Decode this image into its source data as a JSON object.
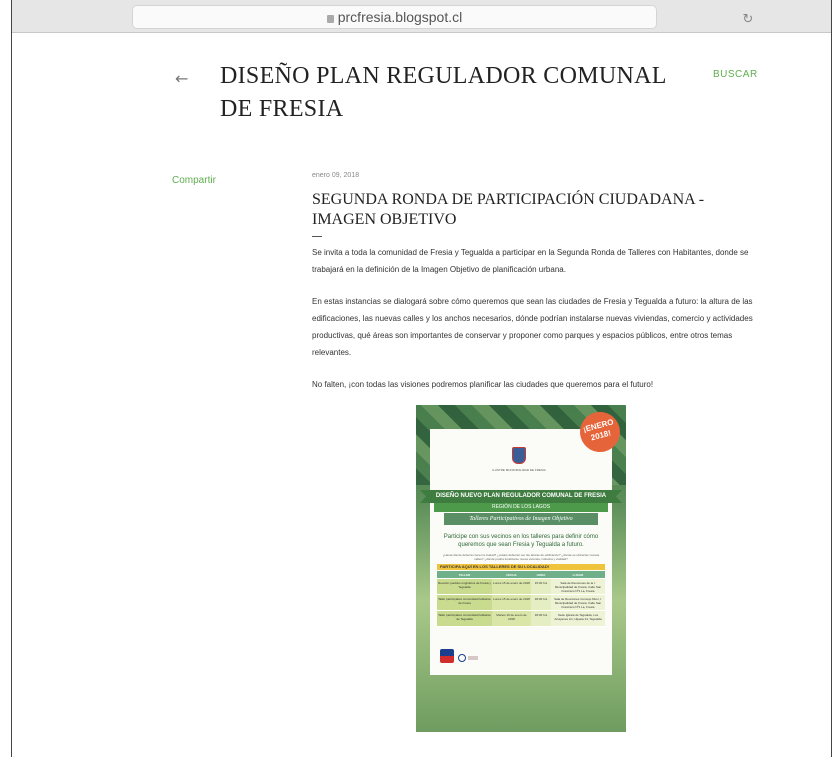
{
  "browser": {
    "url": "prcfresia.blogspot.cl"
  },
  "blog": {
    "title": "DISEÑO PLAN REGULADOR COMUNAL DE FRESIA",
    "search_label": "BUSCAR",
    "back_icon": "←"
  },
  "sidebar": {
    "share_label": "Compartir"
  },
  "post": {
    "date": "enero 09, 2018",
    "title": "SEGUNDA RONDA DE PARTICIPACIÓN CIUDADANA - IMAGEN OBJETIVO",
    "paragraphs": [
      "Se invita a toda la comunidad de Fresia y Tegualda a participar en la Segunda Ronda de Talleres con Habitantes, donde se trabajará en la definición de la Imagen Objetivo de planificación urbana.",
      "En estas instancias se dialogará sobre cómo queremos que sean las ciudades de Fresia y Tegualda a futuro: la altura de las edificaciones, las nuevas calles y los anchos necesarios, dónde podrían instalarse nuevas viviendas, comercio y actividades productivas, qué áreas son importantes de conservar y proponer como parques y espacios públicos, entre otros temas relevantes.",
      "No falten, ¡con todas las visiones podremos planificar las ciudades que queremos para el futuro!"
    ]
  },
  "poster": {
    "badge": "¡ENERO 2018!",
    "municipality": "ILUSTRE MUNICIPALIDAD DE FRESIA",
    "band_title": "DISEÑO NUEVO PLAN REGULADOR COMUNAL DE FRESIA",
    "band_region": "REGIÓN DE LOS LAGOS",
    "band_subtitle": "Talleres Participativos de Imagen Objetivo",
    "lead": "Participe con sus vecinos en los talleres para definir cómo queremos que sean Fresia y Tegualda a futuro.",
    "small_text": "¿Hasta dónde debería crecer la ciudad? ¿cuáles deberían ser las alturas de edificación? ¿dónde se ubicarían nuevas calles? ¿dónde podría localizarse nueva vivienda, industria y vialidad?",
    "table_heading": "PARTICIPA AQUÍ EN LOS TALLERES DE SU LOCALIDAD!",
    "table_headers": [
      "TALLER",
      "FECHA",
      "HORA",
      "LUGAR"
    ],
    "table_rows": [
      [
        "Reunión pueblos originarios de Fresia y Tegualda",
        "Lunes 15 de enero de 2018",
        "15:00 hrs",
        "Sala de Reuniones de la I. Municipalidad de Fresia, Calle San Francisco Nº1 La, Fresia"
      ],
      [
        "Taller participativo comunidad habitante de Fresia",
        "Lunes 15 de enero de 2018",
        "18:00 hrs",
        "Sala de Reuniones Concejo Muni, I. Municipalidad de Fresia, Calle San Francisco Nº1 La, Fresia"
      ],
      [
        "Taller participativo comunidad habitante de Tegualda",
        "Martes 16 de enero de 2018",
        "18:00 hrs",
        "Sede Iglesia de Tegualda, Los Arrayanes s/n, Hijuela 14, Tegualda"
      ]
    ]
  }
}
